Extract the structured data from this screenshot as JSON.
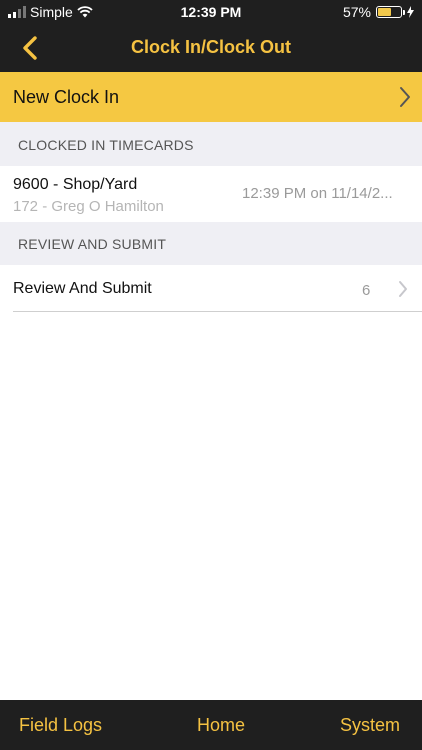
{
  "status": {
    "carrier": "Simple",
    "time": "12:39 PM",
    "battery": "57%",
    "battery_level": 0.57
  },
  "nav": {
    "title": "Clock In/Clock Out",
    "back_icon": "chevron-left-icon"
  },
  "new_clock_in": {
    "label": "New Clock In"
  },
  "sections": {
    "clocked_in": "CLOCKED IN TIMECARDS",
    "review": "REVIEW AND SUBMIT"
  },
  "timecards": [
    {
      "job": "9600 - Shop/Yard",
      "employee": "172 - Greg O Hamilton",
      "time": "12:39 PM on 11/14/2..."
    }
  ],
  "review": {
    "label": "Review And Submit",
    "count": "6"
  },
  "tabs": [
    {
      "label": "Field Logs"
    },
    {
      "label": "Home"
    },
    {
      "label": "System"
    }
  ],
  "colors": {
    "accent": "#f5c242",
    "banner": "#f5c842",
    "bar": "#1f1f1f"
  }
}
